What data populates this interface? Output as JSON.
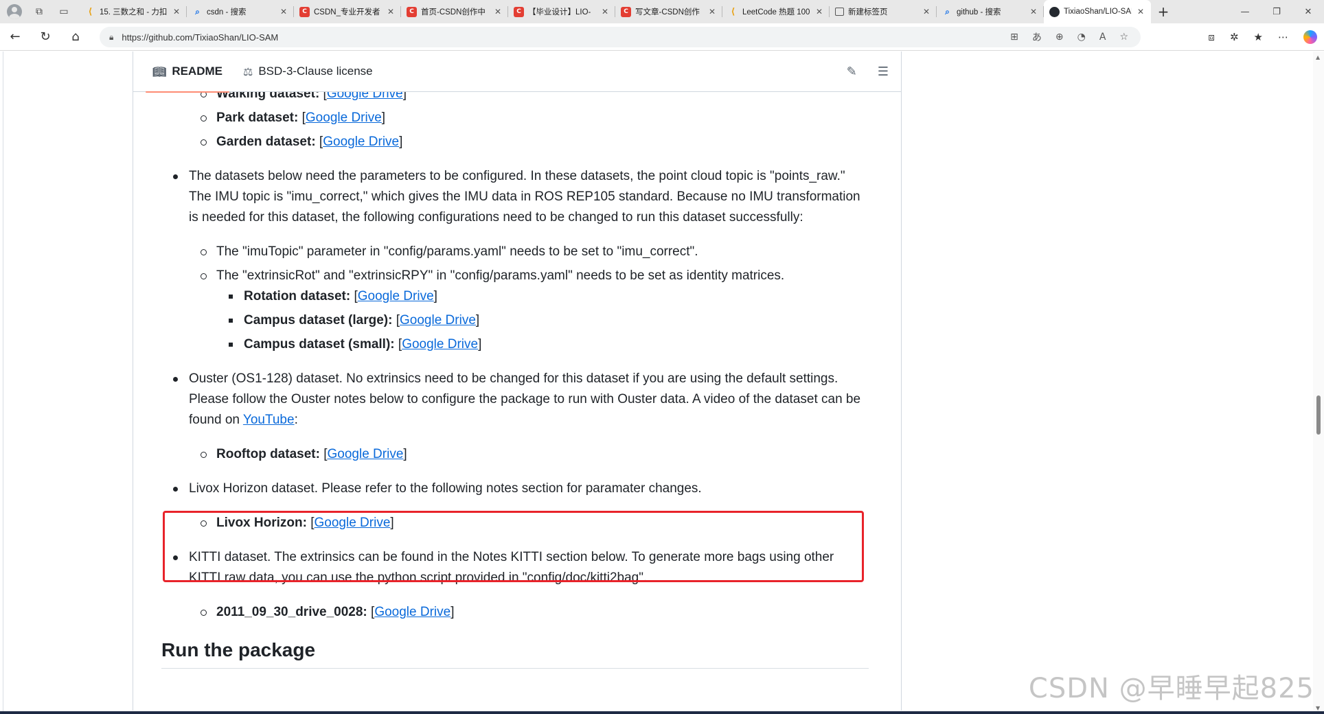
{
  "browser": {
    "tabs": [
      {
        "title": "15. 三数之和 - 力扣",
        "favicon": "leetcode-icon"
      },
      {
        "title": "csdn - 搜索",
        "favicon": "search-icon"
      },
      {
        "title": "CSDN_专业开发者",
        "favicon": "csdn-icon"
      },
      {
        "title": "首页-CSDN创作中",
        "favicon": "csdn-icon"
      },
      {
        "title": "【毕业设计】LIO-",
        "favicon": "csdn-icon"
      },
      {
        "title": "写文章-CSDN创作",
        "favicon": "csdn-icon"
      },
      {
        "title": "LeetCode 热题 100",
        "favicon": "leetcode-icon"
      },
      {
        "title": "新建标签页",
        "favicon": "newtab-icon"
      },
      {
        "title": "github - 搜索",
        "favicon": "search-icon"
      },
      {
        "title": "TixiaoShan/LIO-SAM",
        "favicon": "github-icon",
        "active": true
      }
    ],
    "url": "https://github.com/TixiaoShan/LIO-SAM"
  },
  "readme": {
    "tabs": [
      {
        "label": "README",
        "active": true,
        "icon": "book-icon"
      },
      {
        "label": "BSD-3-Clause license",
        "icon": "scale-icon"
      }
    ],
    "items": {
      "walking": {
        "label": "Walking dataset:",
        "link": "Google Drive"
      },
      "park": {
        "label": "Park dataset:",
        "link": "Google Drive"
      },
      "garden": {
        "label": "Garden dataset:",
        "link": "Google Drive"
      },
      "config_para": "The datasets below need the parameters to be configured. In these datasets, the point cloud topic is \"points_raw.\" The IMU topic is \"imu_correct,\" which gives the IMU data in ROS REP105 standard. Because no IMU transformation is needed for this dataset, the following configurations need to be changed to run this dataset successfully:",
      "imu_topic": "The \"imuTopic\" parameter in \"config/params.yaml\" needs to be set to \"imu_correct\".",
      "extrinsic": "The \"extrinsicRot\" and \"extrinsicRPY\" in \"config/params.yaml\" needs to be set as identity matrices.",
      "rotation": {
        "label": "Rotation dataset:",
        "link": "Google Drive"
      },
      "campus_large": {
        "label": "Campus dataset (large):",
        "link": "Google Drive"
      },
      "campus_small": {
        "label": "Campus dataset (small):",
        "link": "Google Drive"
      },
      "ouster_para": "Ouster (OS1-128) dataset. No extrinsics need to be changed for this dataset if you are using the default settings. Please follow the Ouster notes below to configure the package to run with Ouster data. A video of the dataset can be found on",
      "ouster_link": "YouTube",
      "rooftop": {
        "label": "Rooftop dataset:",
        "link": "Google Drive"
      },
      "livox_para": "Livox Horizon dataset. Please refer to the following notes section for paramater changes.",
      "livox": {
        "label": "Livox Horizon:",
        "link": "Google Drive"
      },
      "kitti_para": "KITTI dataset. The extrinsics can be found in the Notes KITTI section below. To generate more bags using other KITTI raw data, you can use the python script provided in \"config/doc/kitti2bag\".",
      "kitti_drive": {
        "label": "2011_09_30_drive_0028:",
        "link": "Google Drive"
      }
    },
    "heading": "Run the package"
  },
  "watermark": "CSDN @早睡早起825",
  "colors": {
    "link": "#0969da",
    "highlight_box": "#e8232a",
    "tab_underline": "#fd8c73"
  }
}
